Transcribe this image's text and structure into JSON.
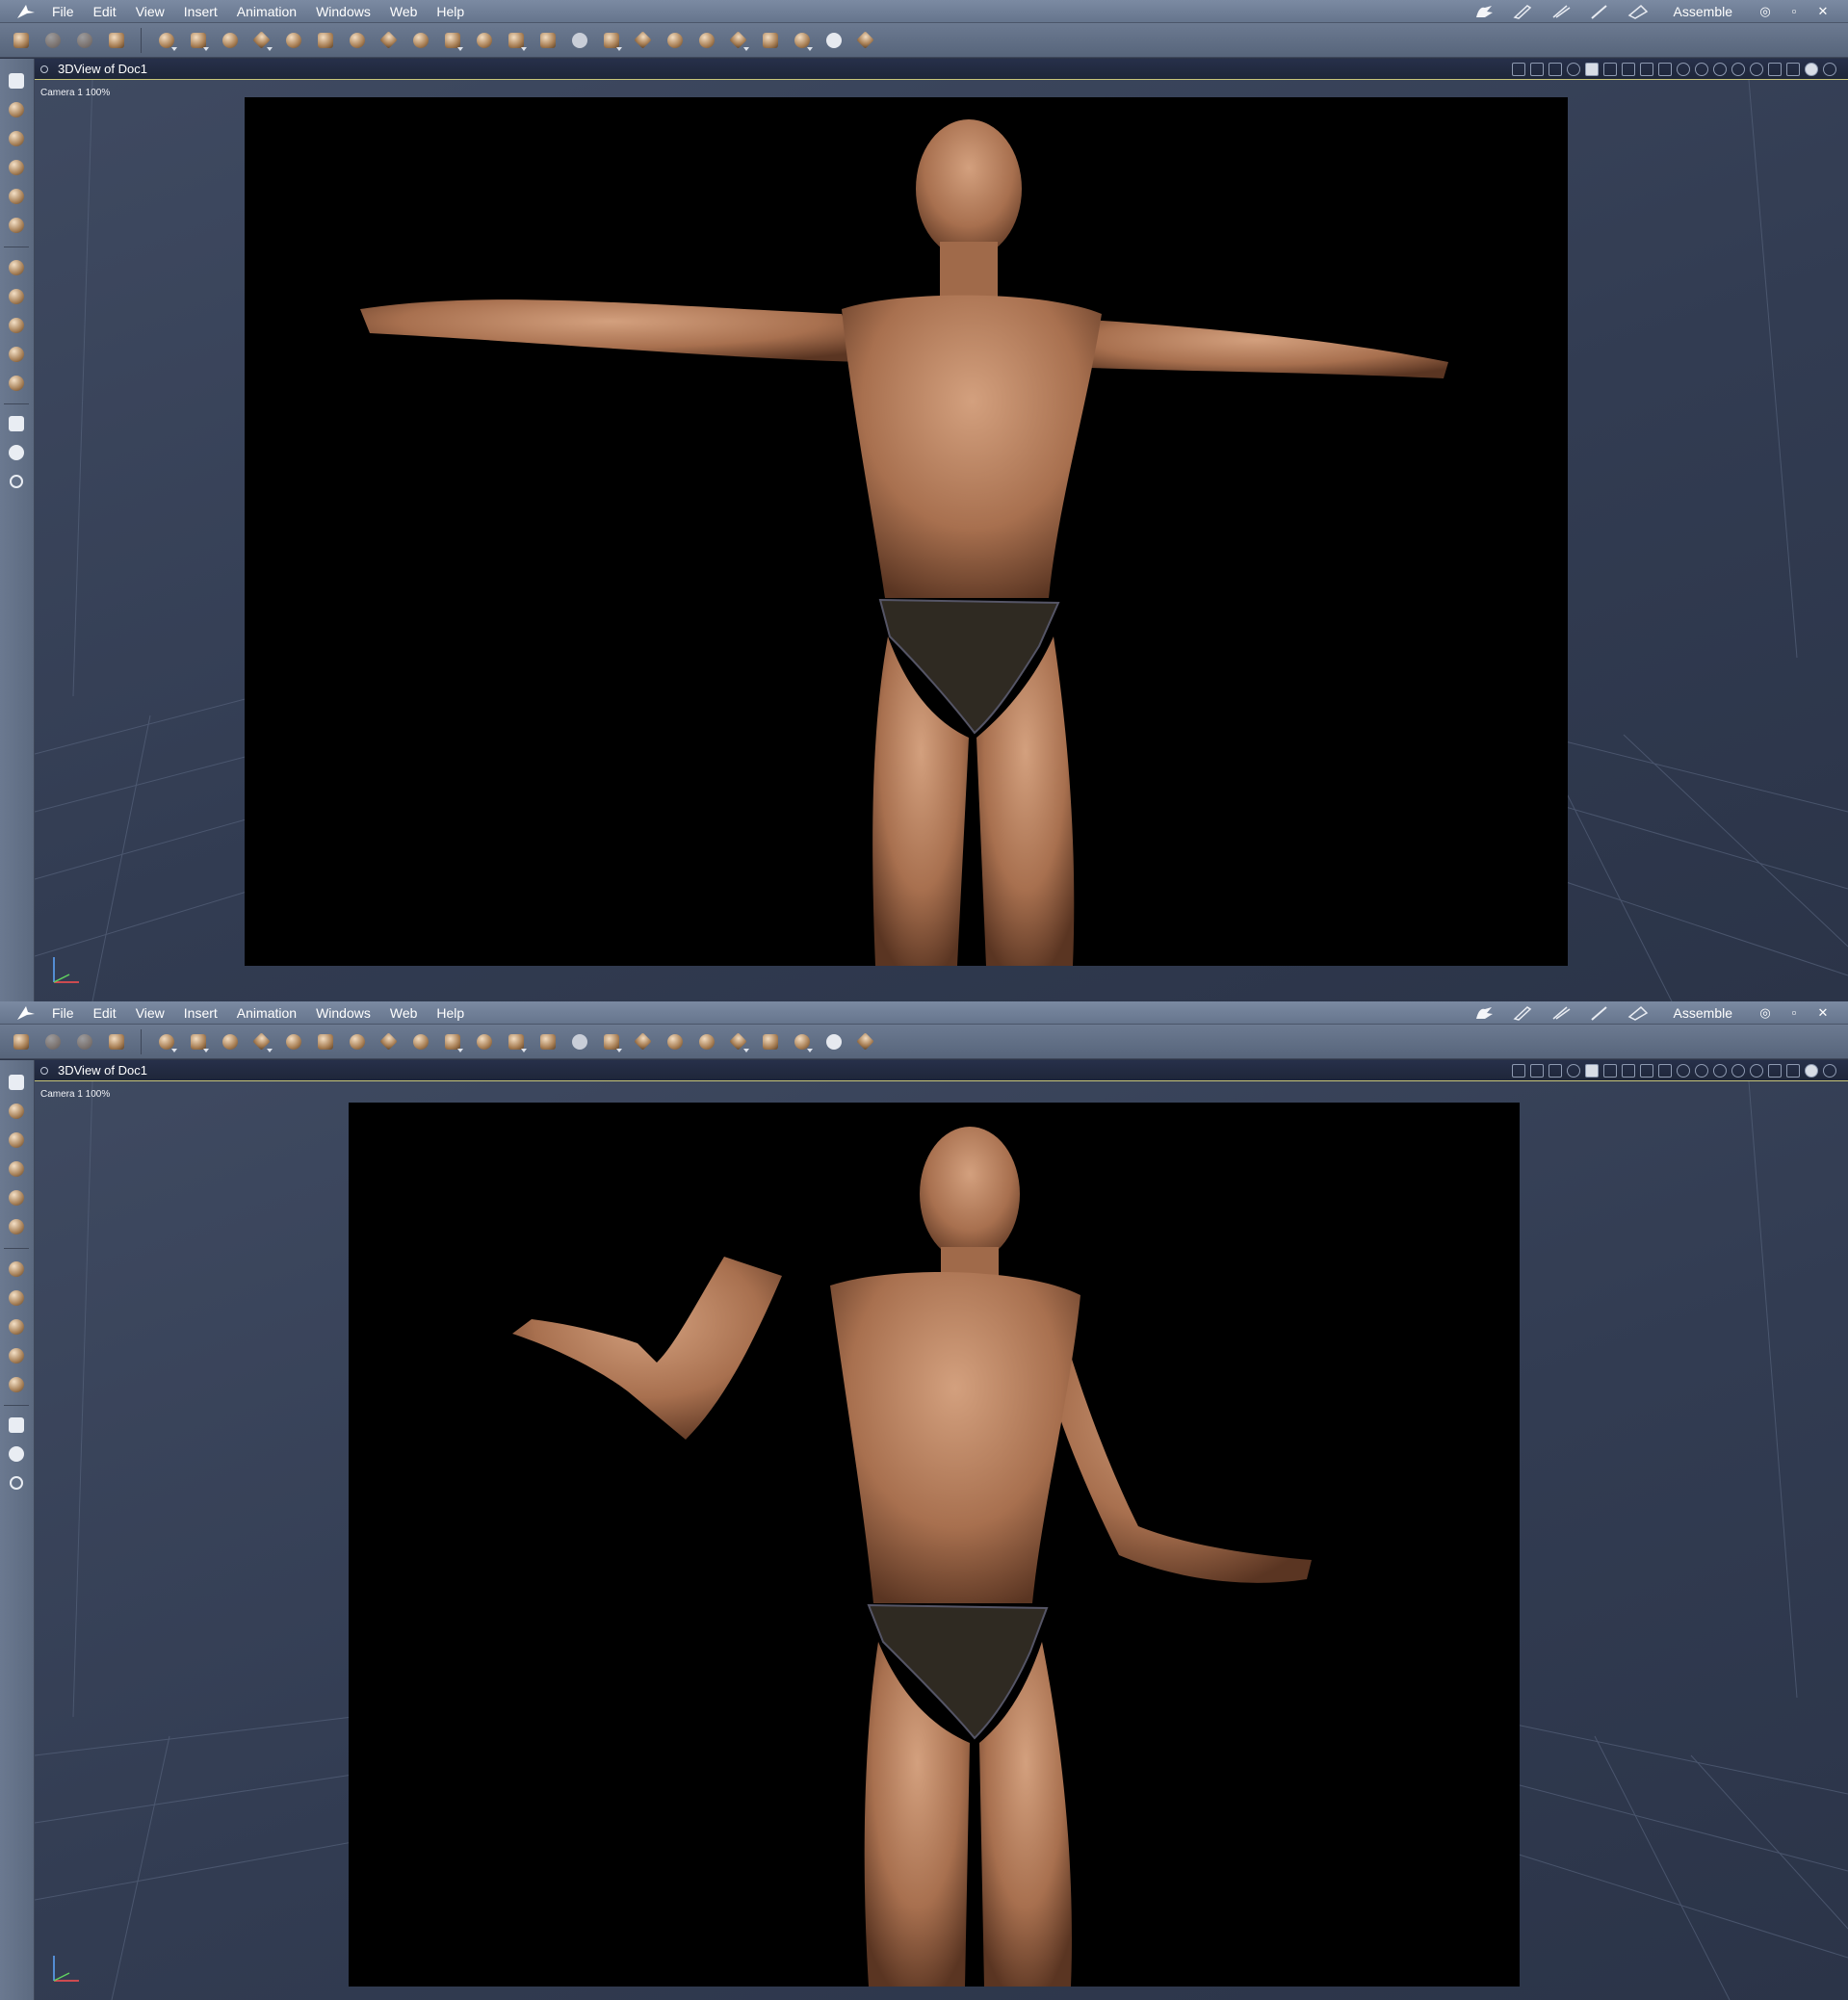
{
  "menu": {
    "items": [
      "File",
      "Edit",
      "View",
      "Insert",
      "Animation",
      "Windows",
      "Web",
      "Help"
    ],
    "room": "Assemble",
    "window_controls": [
      "eye",
      "restore",
      "close"
    ]
  },
  "toolbar": {
    "icons": [
      "edit-wand-icon",
      "hand-grab-icon",
      "pen-tool-icon",
      "paint-brush-icon",
      "sphere-primitive-icon",
      "figure-icon",
      "globe-icon",
      "pose-icon",
      "ring-icon",
      "text-T-icon",
      "gear-icon",
      "plane-icon",
      "tree-icon",
      "hat-icon",
      "candle-icon",
      "cube-cluster-icon",
      "cube-stack-icon",
      "agt-icon",
      "cylinder-icon",
      "house-icon",
      "bowl-icon",
      "rock-icon",
      "pin-icon",
      "film-icon",
      "people-icon",
      "target-icon",
      "wand-icon"
    ]
  },
  "views": [
    {
      "id": "a",
      "title": "3DView of Doc1",
      "camera_label": "Camera 1 100%",
      "pose": "t-pose"
    },
    {
      "id": "b",
      "title": "3DView of Doc1",
      "camera_label": "Camera 1 100%",
      "pose": "shrug"
    }
  ],
  "colors": {
    "menubar": "#6f7f98",
    "toolbar": "#617088",
    "viewport": "#39435a",
    "header_accent": "#c9c67a",
    "skin": "#b98462",
    "briefs": "#2f2a22"
  }
}
